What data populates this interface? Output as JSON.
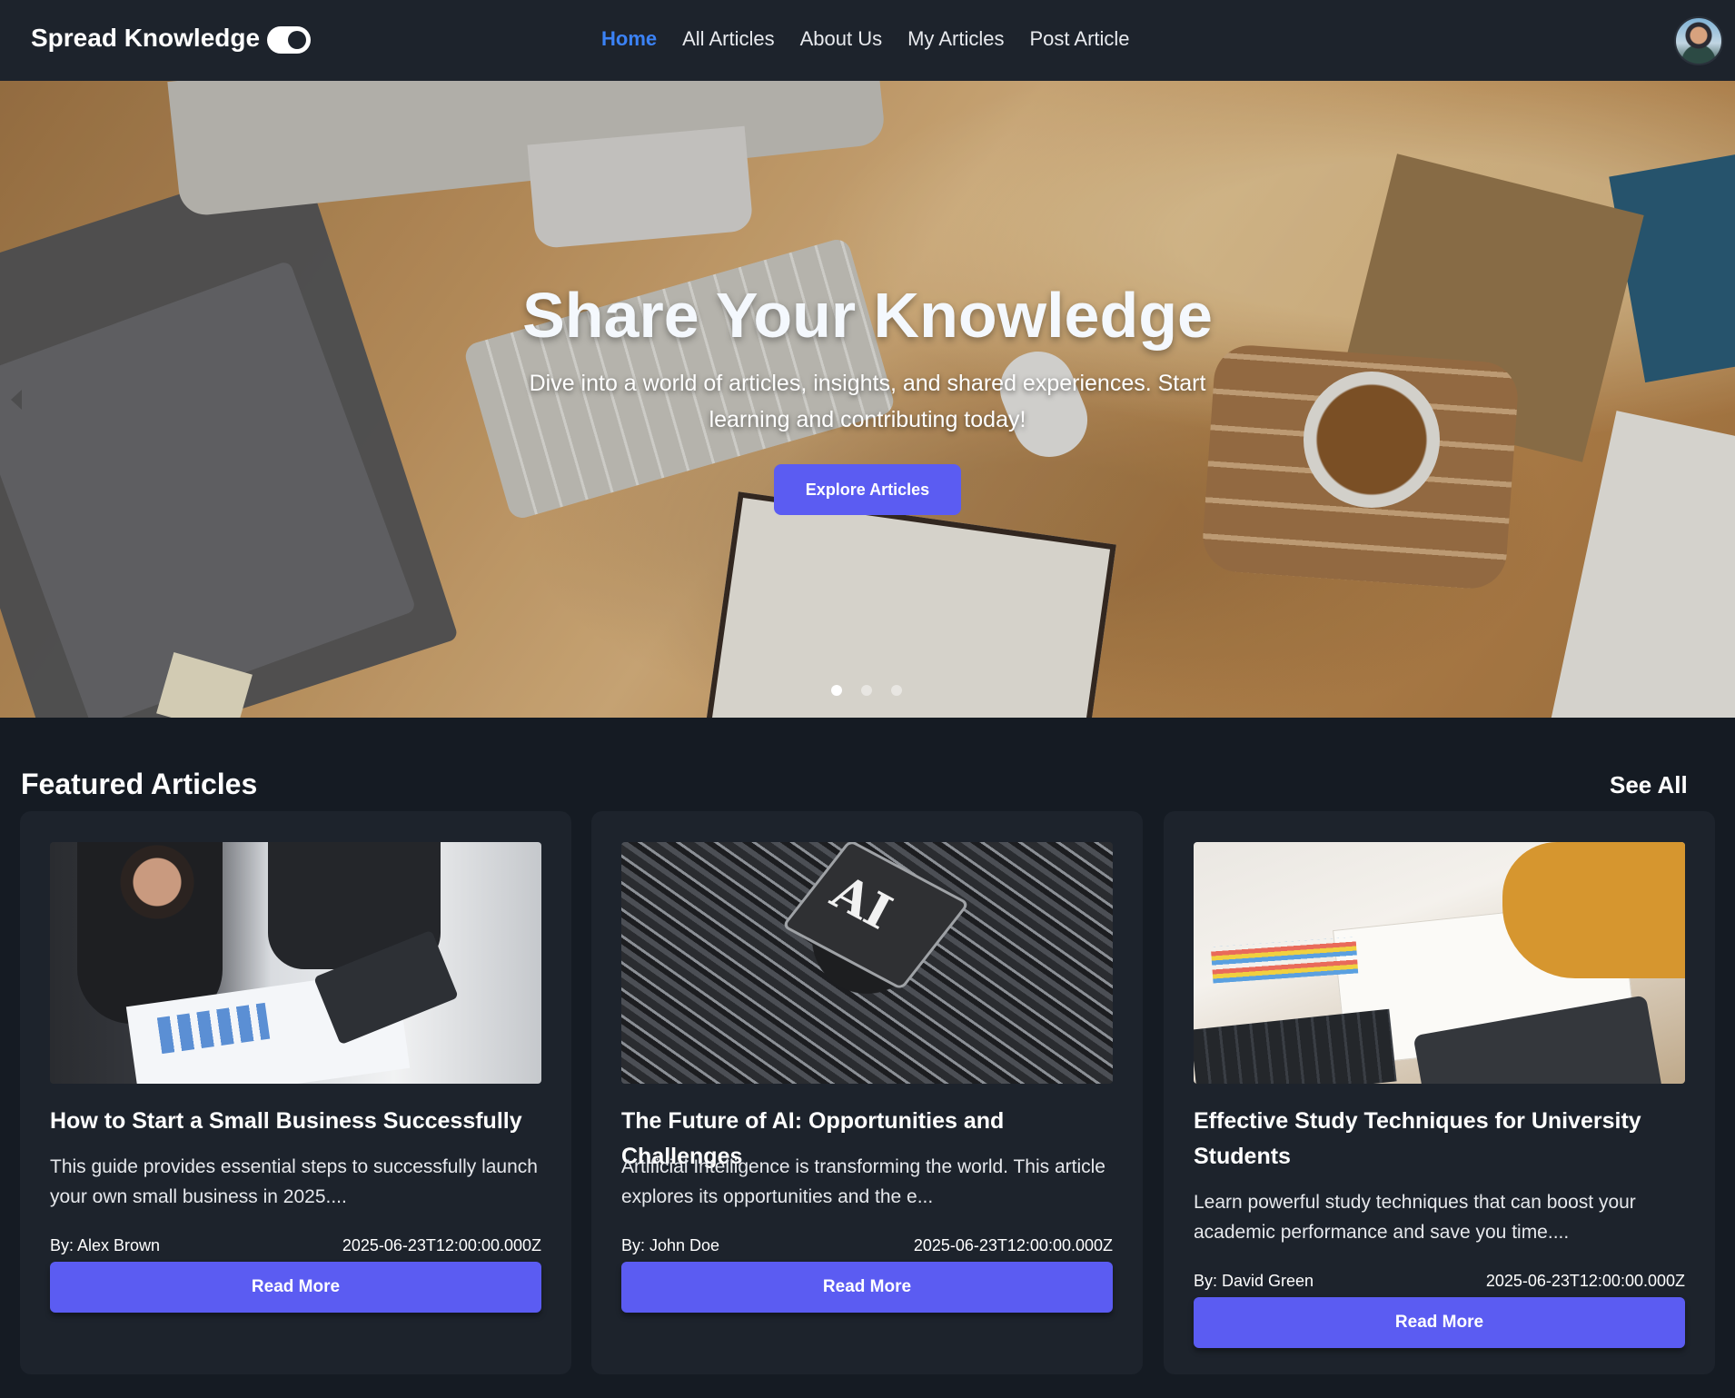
{
  "header": {
    "brand": "Spread Knowledge",
    "nav": [
      "Home",
      "All Articles",
      "About Us",
      "My Articles",
      "Post Article"
    ],
    "active_nav": "Home"
  },
  "hero": {
    "title": "Share Your Knowledge",
    "subtitle": "Dive into a world of articles, insights, and shared experiences. Start learning and contributing today!",
    "cta": "Explore Articles",
    "slide_count": 3,
    "active_slide": 0
  },
  "featured": {
    "title": "Featured Articles",
    "see_all": "See All",
    "cards": [
      {
        "title": "How to Start a Small Business Successfully",
        "description": "This guide provides essential steps to successfully launch your own small business in 2025....",
        "author": "By: Alex Brown",
        "date": "2025-06-23T12:00:00.000Z",
        "button": "Read More"
      },
      {
        "title": "The Future of AI: Opportunities and Challenges",
        "description": "Artificial Intelligence is transforming the world. This article explores its opportunities and the e...",
        "author": "By: John Doe",
        "date": "2025-06-23T12:00:00.000Z",
        "button": "Read More",
        "image_text": "AI"
      },
      {
        "title": "Effective Study Techniques for University Students",
        "description": "Learn powerful study techniques that can boost your academic performance and save you time....",
        "author": "By: David Green",
        "date": "2025-06-23T12:00:00.000Z",
        "button": "Read More"
      }
    ]
  },
  "colors": {
    "navbar_bg": "#1d232c",
    "page_bg": "#151b23",
    "accent": "#5b5cf2",
    "active_link": "#3b82f6"
  },
  "icons": {
    "theme_toggle": "toggle-switch-icon",
    "carousel_prev": "chevron-left-icon",
    "avatar": "user-avatar"
  }
}
